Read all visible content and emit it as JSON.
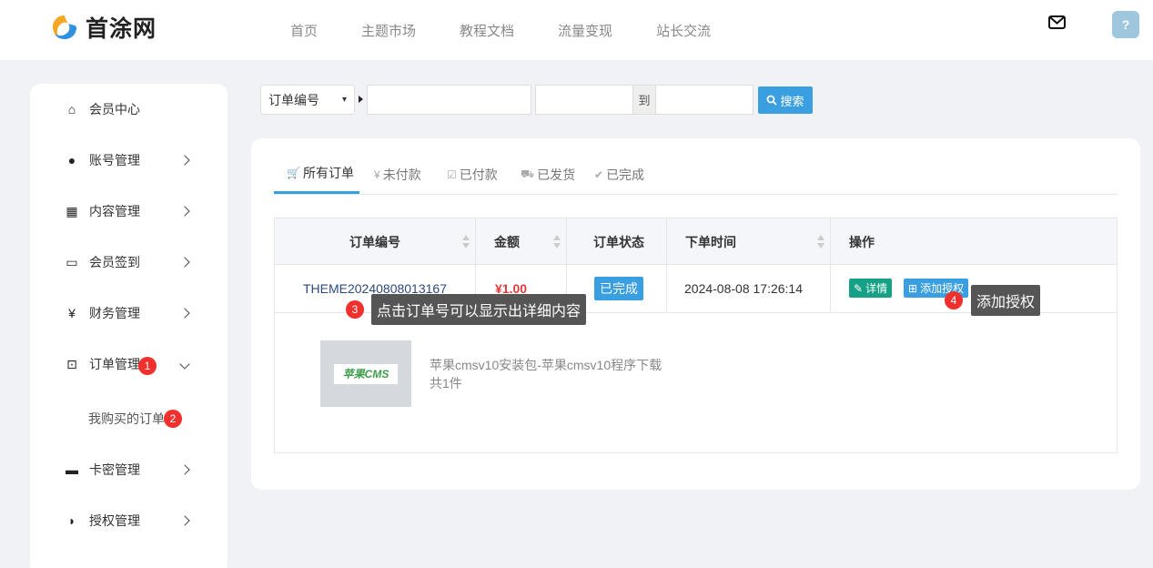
{
  "header": {
    "logo_text": "首涂网",
    "nav": [
      "首页",
      "主题市场",
      "教程文档",
      "流量变现",
      "站长交流"
    ],
    "avatar_text": "?"
  },
  "sidebar": {
    "items": [
      {
        "label": "会员中心",
        "icon": "home-icon",
        "glyph": "⌂"
      },
      {
        "label": "账号管理",
        "icon": "user-icon",
        "glyph": "●"
      },
      {
        "label": "内容管理",
        "icon": "grid-icon",
        "glyph": "▦"
      },
      {
        "label": "会员签到",
        "icon": "calendar-icon",
        "glyph": "▭"
      },
      {
        "label": "财务管理",
        "icon": "yen-icon",
        "glyph": "¥"
      },
      {
        "label": "订单管理",
        "icon": "cart-icon",
        "glyph": "⊡"
      },
      {
        "label": "卡密管理",
        "icon": "card-icon",
        "glyph": "▬"
      },
      {
        "label": "授权管理",
        "icon": "shield-icon",
        "glyph": "◗"
      }
    ],
    "sub_item": "我购买的订单",
    "badges": [
      "1",
      "2"
    ]
  },
  "search": {
    "select_value": "订单编号",
    "to_label": "到",
    "button_label": "搜索"
  },
  "tabs": [
    {
      "label": "所有订单",
      "glyph": "🛒"
    },
    {
      "label": "未付款",
      "glyph": "¥"
    },
    {
      "label": "已付款",
      "glyph": "☑"
    },
    {
      "label": "已发货",
      "glyph": "⛟"
    },
    {
      "label": "已完成",
      "glyph": "✔"
    }
  ],
  "table": {
    "headers": [
      "订单编号",
      "金额",
      "订单状态",
      "下单时间",
      "操作"
    ],
    "row": {
      "order_no": "THEME20240808013167",
      "amount": "¥1.00",
      "status": "已完成",
      "time": "2024-08-08 17:26:14",
      "detail_btn": "详情",
      "auth_btn": "添加授权"
    },
    "product": {
      "thumb_text": "苹果CMS",
      "name": "苹果cmsv10安装包-苹果cmsv10程序下载",
      "qty": "共1件"
    }
  },
  "annotations": {
    "badge3": "3",
    "tip3": "点击订单号可以显示出详细内容",
    "badge4": "4",
    "tip4": "添加授权"
  },
  "colors": {
    "accent": "#3a9fe0",
    "badge": "#f0302d",
    "price": "#e4393c",
    "detail_btn": "#16a085"
  }
}
